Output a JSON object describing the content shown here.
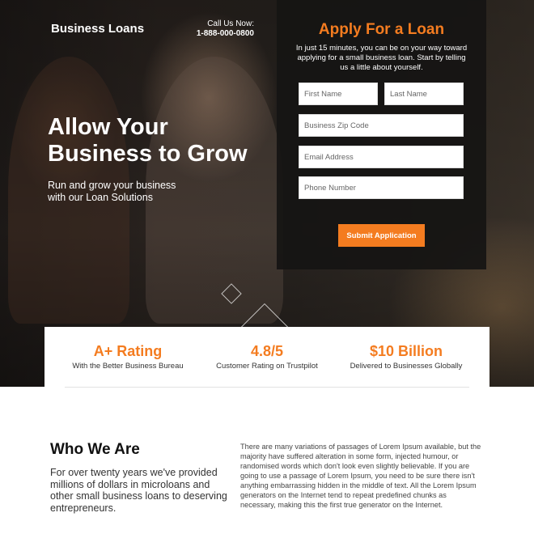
{
  "header": {
    "brand": "Business Loans",
    "call_label": "Call Us Now:",
    "call_number": "1-888-000-0800"
  },
  "hero": {
    "title": "Allow Your Business to Grow",
    "subtitle": "Run and grow your business with our Loan Solutions"
  },
  "form": {
    "title": "Apply For a Loan",
    "description": "In just 15 minutes, you can be on your way toward applying for a small business loan. Start by telling us a little about yourself.",
    "first_name_placeholder": "First Name",
    "last_name_placeholder": "Last Name",
    "zip_placeholder": "Business Zip Code",
    "email_placeholder": "Email Address",
    "phone_placeholder": "Phone Number",
    "submit_label": "Submit Application"
  },
  "stats": [
    {
      "value": "A+ Rating",
      "label": "With the Better Business Bureau"
    },
    {
      "value": "4.8/5",
      "label": "Customer Rating on Trustpilot"
    },
    {
      "value": "$10 Billion",
      "label": "Delivered to Businesses Globally"
    }
  ],
  "about": {
    "title": "Who We Are",
    "lead": "For over twenty years we've provided millions of dollars in microloans and other small business loans to deserving entrepreneurs.",
    "body": "There are many variations of passages of Lorem Ipsum available, but the majority have suffered alteration in some form, injected humour, or randomised words which don't look even slightly believable. If you are going to use a passage of Lorem Ipsum, you need to be sure there isn't anything embarrassing hidden in the middle of text. All the Lorem Ipsum generators on the Internet tend to repeat predefined chunks as necessary, making this the first true generator on the Internet."
  },
  "colors": {
    "accent": "#f47c20",
    "form_background": "#161413",
    "text_dark": "#111111"
  }
}
